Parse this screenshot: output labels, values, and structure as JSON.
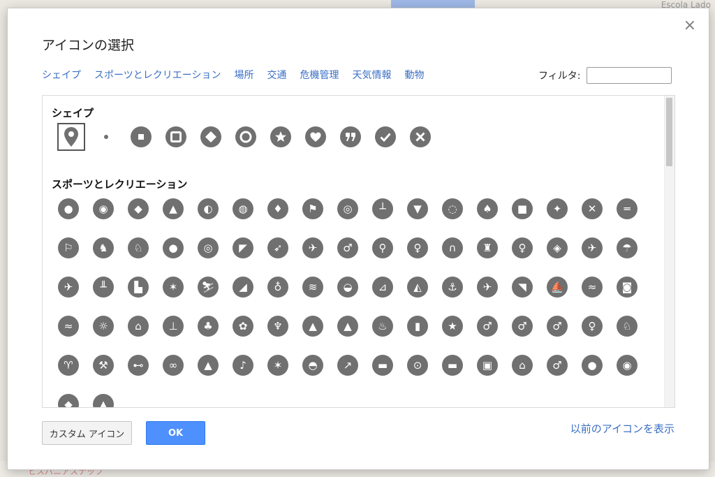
{
  "dialog": {
    "title": "アイコンの選択",
    "close_glyph": "×",
    "categories": [
      "シェイプ",
      "スポーツとレクリエーション",
      "場所",
      "交通",
      "危機管理",
      "天気情報",
      "動物"
    ],
    "filter_label": "フィルタ:",
    "filter_value": "",
    "sections": {
      "shapes_title": "シェイプ",
      "sports_title": "スポーツとレクリエーション"
    },
    "shapes": [
      "map-pin-icon",
      "small-dot-icon",
      "circle-square-icon",
      "rounded-square-icon",
      "diamond-icon",
      "ring-icon",
      "star-icon",
      "heart-icon",
      "quote-icon",
      "check-icon",
      "cross-icon"
    ],
    "sports_rows": [
      [
        "baseball-icon",
        "basketball-icon",
        "football-icon",
        "soccer-icon",
        "rugby-icon",
        "volleyball-icon",
        "golfer-icon",
        "golf-flag-icon",
        "magnifier-ball-icon",
        "curling-icon",
        "bowling-pins-icon",
        "tennis-ball-icon",
        "racket-icon",
        "boxing-glove-icon",
        "martial-arts-icon",
        "fencing-icon",
        "dumbbell-icon"
      ],
      [
        "checkered-flag-icon",
        "rodeo-icon",
        "horse-icon",
        "bowling-ball-icon",
        "billiards-icon",
        "cricket-icon",
        "archery-icon",
        "runner-icon",
        "hiker-icon",
        "cyclist-icon",
        "dancer-icon",
        "climbing-icon",
        "climbing-wall-icon",
        "skater-icon",
        "disc-icon",
        "skateboard-icon",
        "paragliding-icon"
      ],
      [
        "snowboard-icon",
        "hockey-icon",
        "ice-skate-icon",
        "skier-icon",
        "cross-country-ski-icon",
        "sledding-icon",
        "snowshoe-icon",
        "ski-jump-icon",
        "ski-walker-icon",
        "jet-ski-icon",
        "kayak-icon",
        "rowing-icon",
        "sailboat-icon",
        "waterski-icon",
        "surfer-icon",
        "wakeboard-icon",
        "windsurf-icon"
      ],
      [
        "swimming-icon",
        "diving-mask-icon",
        "swimmer-icon",
        "fish-icon",
        "fishing-icon",
        "beach-ball-icon",
        "playground-icon",
        "picnic-table-icon",
        "pine-tree-icon",
        "deciduous-tree-icon",
        "palm-tree-icon",
        "mountain-icon",
        "volcano-icon",
        "hot-spring-icon",
        "waterfall-icon",
        "star-icon",
        "hiker-poles-icon"
      ],
      [
        "backpacker-icon",
        "couple-hiking-icon",
        "binoculars-person-icon",
        "deer-icon",
        "bird-watch-icon",
        "mining-icon",
        "telescope-icon",
        "binoculars-icon",
        "tent-icon",
        "guitar-icon",
        "campfire-icon",
        "barbecue-icon",
        "hatchet-icon",
        "camper-icon",
        "motorcycle-icon",
        "rv-icon",
        "caravan-icon"
      ],
      [
        "playhouse-icon",
        "tennis-player-icon"
      ]
    ],
    "custom_button": "カスタム アイコン",
    "ok_button": "OK",
    "prev_icons_link": "以前のアイコンを表示"
  },
  "background": {
    "map_label_top": "Escola Lado",
    "map_label_bottom": "ヒスパニアスナップ"
  },
  "colors": {
    "icon_fill": "#707070",
    "link": "#3b6fc4",
    "ok": "#4d90fe"
  }
}
